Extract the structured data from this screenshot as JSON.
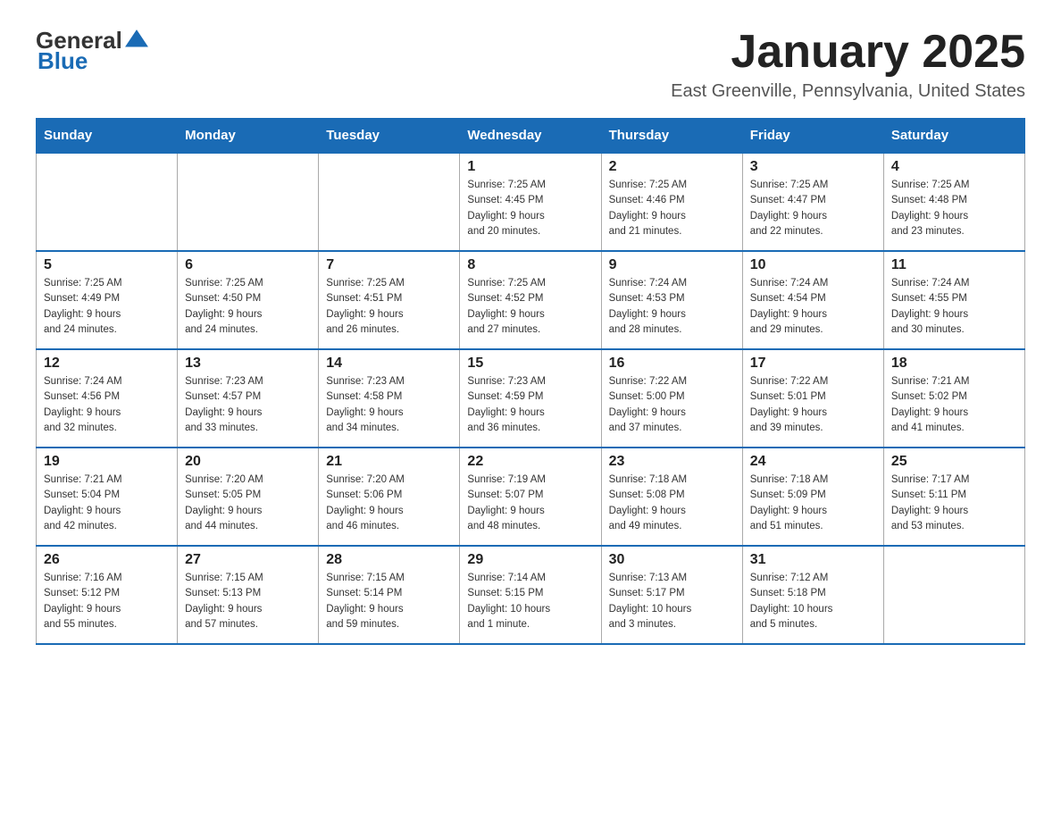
{
  "header": {
    "logo_general": "General",
    "logo_blue": "Blue",
    "month": "January 2025",
    "location": "East Greenville, Pennsylvania, United States"
  },
  "days_of_week": [
    "Sunday",
    "Monday",
    "Tuesday",
    "Wednesday",
    "Thursday",
    "Friday",
    "Saturday"
  ],
  "weeks": [
    [
      {
        "day": "",
        "info": ""
      },
      {
        "day": "",
        "info": ""
      },
      {
        "day": "",
        "info": ""
      },
      {
        "day": "1",
        "info": "Sunrise: 7:25 AM\nSunset: 4:45 PM\nDaylight: 9 hours\nand 20 minutes."
      },
      {
        "day": "2",
        "info": "Sunrise: 7:25 AM\nSunset: 4:46 PM\nDaylight: 9 hours\nand 21 minutes."
      },
      {
        "day": "3",
        "info": "Sunrise: 7:25 AM\nSunset: 4:47 PM\nDaylight: 9 hours\nand 22 minutes."
      },
      {
        "day": "4",
        "info": "Sunrise: 7:25 AM\nSunset: 4:48 PM\nDaylight: 9 hours\nand 23 minutes."
      }
    ],
    [
      {
        "day": "5",
        "info": "Sunrise: 7:25 AM\nSunset: 4:49 PM\nDaylight: 9 hours\nand 24 minutes."
      },
      {
        "day": "6",
        "info": "Sunrise: 7:25 AM\nSunset: 4:50 PM\nDaylight: 9 hours\nand 24 minutes."
      },
      {
        "day": "7",
        "info": "Sunrise: 7:25 AM\nSunset: 4:51 PM\nDaylight: 9 hours\nand 26 minutes."
      },
      {
        "day": "8",
        "info": "Sunrise: 7:25 AM\nSunset: 4:52 PM\nDaylight: 9 hours\nand 27 minutes."
      },
      {
        "day": "9",
        "info": "Sunrise: 7:24 AM\nSunset: 4:53 PM\nDaylight: 9 hours\nand 28 minutes."
      },
      {
        "day": "10",
        "info": "Sunrise: 7:24 AM\nSunset: 4:54 PM\nDaylight: 9 hours\nand 29 minutes."
      },
      {
        "day": "11",
        "info": "Sunrise: 7:24 AM\nSunset: 4:55 PM\nDaylight: 9 hours\nand 30 minutes."
      }
    ],
    [
      {
        "day": "12",
        "info": "Sunrise: 7:24 AM\nSunset: 4:56 PM\nDaylight: 9 hours\nand 32 minutes."
      },
      {
        "day": "13",
        "info": "Sunrise: 7:23 AM\nSunset: 4:57 PM\nDaylight: 9 hours\nand 33 minutes."
      },
      {
        "day": "14",
        "info": "Sunrise: 7:23 AM\nSunset: 4:58 PM\nDaylight: 9 hours\nand 34 minutes."
      },
      {
        "day": "15",
        "info": "Sunrise: 7:23 AM\nSunset: 4:59 PM\nDaylight: 9 hours\nand 36 minutes."
      },
      {
        "day": "16",
        "info": "Sunrise: 7:22 AM\nSunset: 5:00 PM\nDaylight: 9 hours\nand 37 minutes."
      },
      {
        "day": "17",
        "info": "Sunrise: 7:22 AM\nSunset: 5:01 PM\nDaylight: 9 hours\nand 39 minutes."
      },
      {
        "day": "18",
        "info": "Sunrise: 7:21 AM\nSunset: 5:02 PM\nDaylight: 9 hours\nand 41 minutes."
      }
    ],
    [
      {
        "day": "19",
        "info": "Sunrise: 7:21 AM\nSunset: 5:04 PM\nDaylight: 9 hours\nand 42 minutes."
      },
      {
        "day": "20",
        "info": "Sunrise: 7:20 AM\nSunset: 5:05 PM\nDaylight: 9 hours\nand 44 minutes."
      },
      {
        "day": "21",
        "info": "Sunrise: 7:20 AM\nSunset: 5:06 PM\nDaylight: 9 hours\nand 46 minutes."
      },
      {
        "day": "22",
        "info": "Sunrise: 7:19 AM\nSunset: 5:07 PM\nDaylight: 9 hours\nand 48 minutes."
      },
      {
        "day": "23",
        "info": "Sunrise: 7:18 AM\nSunset: 5:08 PM\nDaylight: 9 hours\nand 49 minutes."
      },
      {
        "day": "24",
        "info": "Sunrise: 7:18 AM\nSunset: 5:09 PM\nDaylight: 9 hours\nand 51 minutes."
      },
      {
        "day": "25",
        "info": "Sunrise: 7:17 AM\nSunset: 5:11 PM\nDaylight: 9 hours\nand 53 minutes."
      }
    ],
    [
      {
        "day": "26",
        "info": "Sunrise: 7:16 AM\nSunset: 5:12 PM\nDaylight: 9 hours\nand 55 minutes."
      },
      {
        "day": "27",
        "info": "Sunrise: 7:15 AM\nSunset: 5:13 PM\nDaylight: 9 hours\nand 57 minutes."
      },
      {
        "day": "28",
        "info": "Sunrise: 7:15 AM\nSunset: 5:14 PM\nDaylight: 9 hours\nand 59 minutes."
      },
      {
        "day": "29",
        "info": "Sunrise: 7:14 AM\nSunset: 5:15 PM\nDaylight: 10 hours\nand 1 minute."
      },
      {
        "day": "30",
        "info": "Sunrise: 7:13 AM\nSunset: 5:17 PM\nDaylight: 10 hours\nand 3 minutes."
      },
      {
        "day": "31",
        "info": "Sunrise: 7:12 AM\nSunset: 5:18 PM\nDaylight: 10 hours\nand 5 minutes."
      },
      {
        "day": "",
        "info": ""
      }
    ]
  ]
}
